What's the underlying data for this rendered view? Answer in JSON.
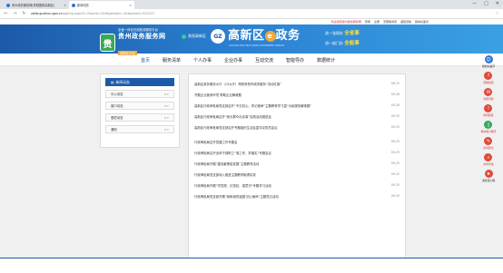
{
  "browser": {
    "tabs": [
      {
        "label": "贵州政务服务网(贵阳国家高新区)",
        "active": false
      },
      {
        "label": "新闻动态",
        "active": true
      }
    ],
    "url_host": "zwfw.guizhou.gov.cn",
    "url_path": "/bqtmp.aspx?t=2&ocId=2&PageIndex=1&banaeid=520127",
    "window_controls": [
      "—",
      "□",
      "✕"
    ]
  },
  "toplinks": {
    "notice": "欢迎来到贵州政务服务网",
    "items": [
      "登录",
      "注册",
      "无障碍浏览",
      "返回旧版",
      "我的好差评"
    ]
  },
  "header": {
    "emblem_char": "贵",
    "line1": "全省一体化在线政务服务平台",
    "site_name": "贵州政务服务网",
    "tag": "高新区分站",
    "district": "贵阳高新区",
    "brand_mark": "GZ",
    "brand_title_a": "高新区",
    "brand_title_mark": "e",
    "brand_title_b": "政务",
    "brand_sub": "GUIYANG HIGH-TECH ZONE GOVERNMENT SERVICE",
    "slogan1_prefix": "进一张网办",
    "slogan1_hl": "全省事",
    "slogan2_prefix": "进一扇门办",
    "slogan2_hl": "全能事"
  },
  "nav": {
    "items": [
      "首页",
      "服务清单",
      "个人办事",
      "企业办事",
      "互动交流",
      "智能导办",
      "数据统计"
    ],
    "active_index": 0
  },
  "sidebar": {
    "header": "新闻动态",
    "items": [
      {
        "label": "中心动态",
        "arrow": ">>"
      },
      {
        "label": "窗口动态",
        "arrow": ">>"
      },
      {
        "label": "基层动态",
        "arrow": ">>"
      },
      {
        "label": "通知",
        "arrow": ">>"
      }
    ]
  },
  "news": {
    "rows": [
      {
        "title": "高新区政务服务大厅（15大厅）再获贵阳市政务服务“流动红旗”",
        "date": "08-25"
      },
      {
        "title": "开展企业营商环境 帮助企业解难题",
        "date": "09-28"
      },
      {
        "title": "高新区行政审批局党支部召开“不忘初心、牢记使命”主题教育学习暨“为民服务解难题”",
        "date": "09-28"
      },
      {
        "title": "高新区行政审批局召开“我为群众办实事”实践活动推进会",
        "date": "09-25"
      },
      {
        "title": "高新区行政审批局党支部召开专题组织生活会暨评议党员会议",
        "date": "09-25"
      },
      {
        "title": "行政审批局召开党建工作专题会",
        "date": "09-25"
      },
      {
        "title": "行政审批局召开全体干部职工“谋工作、抓落实”专题会议",
        "date": "09-25"
      },
      {
        "title": "行政审批局开展“建言献策促发展”主题教育活动",
        "date": "09-25"
      },
      {
        "title": "行政审批局党支部深入推进主题教育取得实效",
        "date": "09-25"
      },
      {
        "title": "行政审批局开展“学党规、记党纪、强意识”专题学习活动",
        "date": "09-25"
      },
      {
        "title": "行政审批局党支部开展“我和我的祖国·初心使命”主题党日活动",
        "date": "09-25"
      }
    ]
  },
  "rightbar": [
    {
      "label": "我的好差评",
      "color": "#2f78d6",
      "icon": "user-icon"
    },
    {
      "label": "帮助指南",
      "color": "#e04b3a",
      "icon": "help-icon"
    },
    {
      "label": "智能问答",
      "color": "#e04b3a",
      "icon": "chat-icon"
    },
    {
      "label": "你问我答",
      "color": "#e04b3a",
      "icon": "qa-icon"
    },
    {
      "label": "移动端小程序",
      "color": "#39a85a",
      "icon": "mobile-icon"
    },
    {
      "label": "投诉建议",
      "color": "#e04b3a",
      "icon": "complaint-icon"
    },
    {
      "label": "办件查询",
      "color": "#e04b3a",
      "icon": "search-icon"
    },
    {
      "label": "满意度小程",
      "color": "#e04b3a",
      "icon": "star-icon"
    }
  ]
}
